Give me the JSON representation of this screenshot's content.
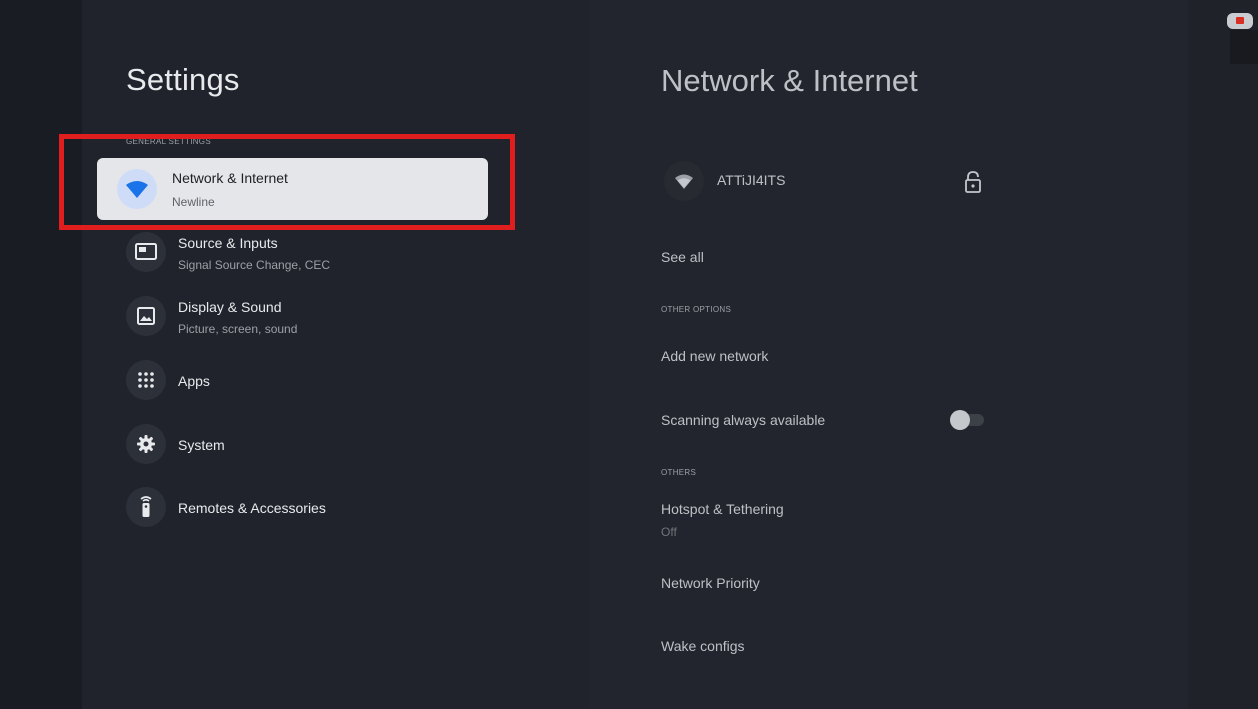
{
  "left": {
    "title": "Settings",
    "section_label": "GENERAL SETTINGS",
    "focused_item": {
      "title": "Network & Internet",
      "subtitle": "Newline",
      "icon": "wifi-icon"
    },
    "items": [
      {
        "title": "Source & Inputs",
        "subtitle": "Signal Source Change, CEC",
        "icon": "input-source-icon"
      },
      {
        "title": "Display & Sound",
        "subtitle": "Picture, screen, sound",
        "icon": "picture-icon"
      },
      {
        "title": "Apps",
        "subtitle": "",
        "icon": "apps-grid-icon"
      },
      {
        "title": "System",
        "subtitle": "",
        "icon": "gear-icon"
      },
      {
        "title": "Remotes & Accessories",
        "subtitle": "",
        "icon": "remote-icon"
      }
    ]
  },
  "right": {
    "title": "Network & Internet",
    "network": {
      "ssid": "ATTiJI4ITS",
      "icon": "wifi-icon",
      "secured_icon": "lock-icon"
    },
    "see_all": "See all",
    "other_options_label": "OTHER OPTIONS",
    "add_network": "Add new network",
    "scanning": {
      "label": "Scanning always available",
      "enabled": false
    },
    "others_label": "OTHERS",
    "hotspot": {
      "label": "Hotspot & Tethering",
      "status": "Off"
    },
    "network_priority": "Network Priority",
    "wake_configs": "Wake configs"
  },
  "colors": {
    "highlight": "#e11e1e",
    "focus_card": "#e4e6ea",
    "wifi_accent": "#1a73e8"
  }
}
